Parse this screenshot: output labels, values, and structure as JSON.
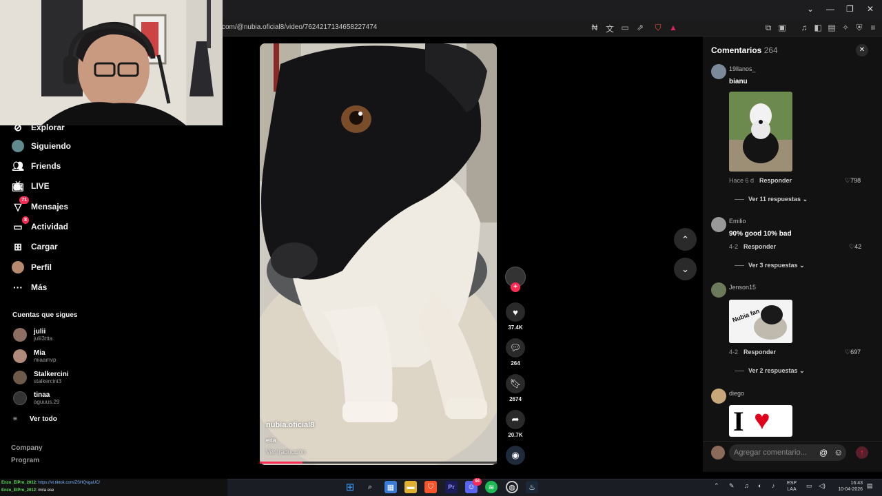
{
  "browser": {
    "url": "com/@nubia.oficial8/video/7624217134658227474",
    "window_controls": [
      "⌄",
      "—",
      "❐",
      "✕"
    ]
  },
  "sidebar": {
    "items": [
      {
        "label": "Explorar",
        "icon": "compass-icon"
      },
      {
        "label": "Siguiendo",
        "icon": "following-avatar-icon"
      },
      {
        "label": "Friends",
        "icon": "friends-icon"
      },
      {
        "label": "LIVE",
        "icon": "live-tv-icon"
      },
      {
        "label": "Mensajes",
        "icon": "messages-icon",
        "badge": "71"
      },
      {
        "label": "Actividad",
        "icon": "activity-icon",
        "badge": "8"
      },
      {
        "label": "Cargar",
        "icon": "upload-plus-icon"
      },
      {
        "label": "Perfil",
        "icon": "profile-avatar-icon"
      },
      {
        "label": "Más",
        "icon": "more-dots-icon"
      }
    ],
    "following_title": "Cuentas que sigues",
    "following": [
      {
        "name": "julii",
        "handle": "julii3ttta"
      },
      {
        "name": "Mia",
        "handle": "miaamvp"
      },
      {
        "name": "Stalkercini",
        "handle": "stalkercini3"
      },
      {
        "name": "tinaa",
        "handle": "aguuus.29"
      }
    ],
    "see_all": "Ver todo",
    "footer": [
      "Company",
      "Program"
    ]
  },
  "video": {
    "author": "nubia.oficial8",
    "caption": "eita",
    "translate": "Ver traducción",
    "progress": 0.18
  },
  "actions": {
    "likes": "37.4K",
    "comments": "264",
    "saves": "2674",
    "shares": "20.7K"
  },
  "comments_panel": {
    "title": "Comentarios",
    "count": "264",
    "reply_label": "Responder",
    "comments": [
      {
        "user": "19llanos_",
        "text": "bianu",
        "time": "Hace 6 d",
        "likes": "798",
        "replies": "Ver 11 respuestas"
      },
      {
        "user": "Emilio",
        "text": "90% good 10% bad",
        "time": "4-2",
        "likes": "42",
        "replies": "Ver 3 respuestas"
      },
      {
        "user": "Jenson15",
        "text": "",
        "time": "4-2",
        "likes": "697",
        "replies": "Ver 2 respuestas",
        "sticker_text": "Nubia fan"
      },
      {
        "user": "diego",
        "text": "",
        "sticker_text": "I"
      }
    ],
    "input_placeholder": "Agregar comentario..."
  },
  "chat": [
    {
      "user": "Enzo_ElPro_2012",
      "msg": "https://vt.tiktok.com/ZSHQvgaUC/"
    },
    {
      "user": "Enzo_ElPro_2012",
      "msg": "mira ese"
    }
  ],
  "tray": {
    "lang": "ESP",
    "lang2": "LAA",
    "time": "16:43",
    "date": "10-04-2026",
    "discord_badge": "94"
  },
  "colors": {
    "accent": "#fe2c55",
    "bg": "#000000",
    "panel": "#121212"
  }
}
